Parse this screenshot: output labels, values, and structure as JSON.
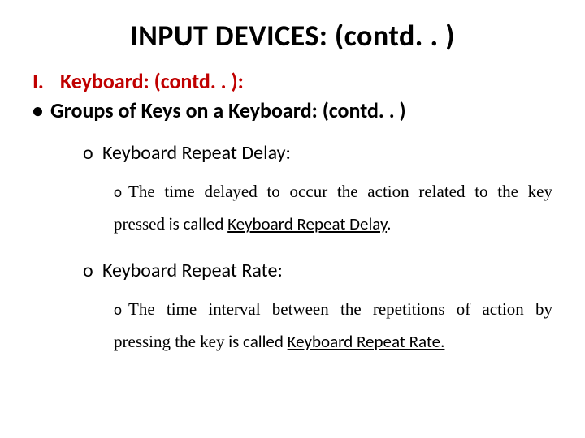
{
  "title": "INPUT DEVICES: (contd. . )",
  "section": {
    "roman": "I.",
    "heading": "Keyboard: (contd. . ):"
  },
  "subheading": {
    "bullet": "•",
    "text": "Groups of Keys on a Keyboard: (contd. . )"
  },
  "items": [
    {
      "bullet": "o",
      "label": "Keyboard Repeat Delay:",
      "detail_bullet": "o",
      "detail_pre": "The time delayed to occur the action related to the key pressed",
      "detail_mid": " is called ",
      "term": "Keyboard Repeat Delay",
      "detail_post": "."
    },
    {
      "bullet": "o",
      "label": "Keyboard Repeat Rate:",
      "detail_bullet": "o",
      "detail_pre": "The time interval between the repetitions of action by pressing the key",
      "detail_mid": " is called ",
      "term": "Keyboard Repeat Rate.",
      "detail_post": ""
    }
  ]
}
